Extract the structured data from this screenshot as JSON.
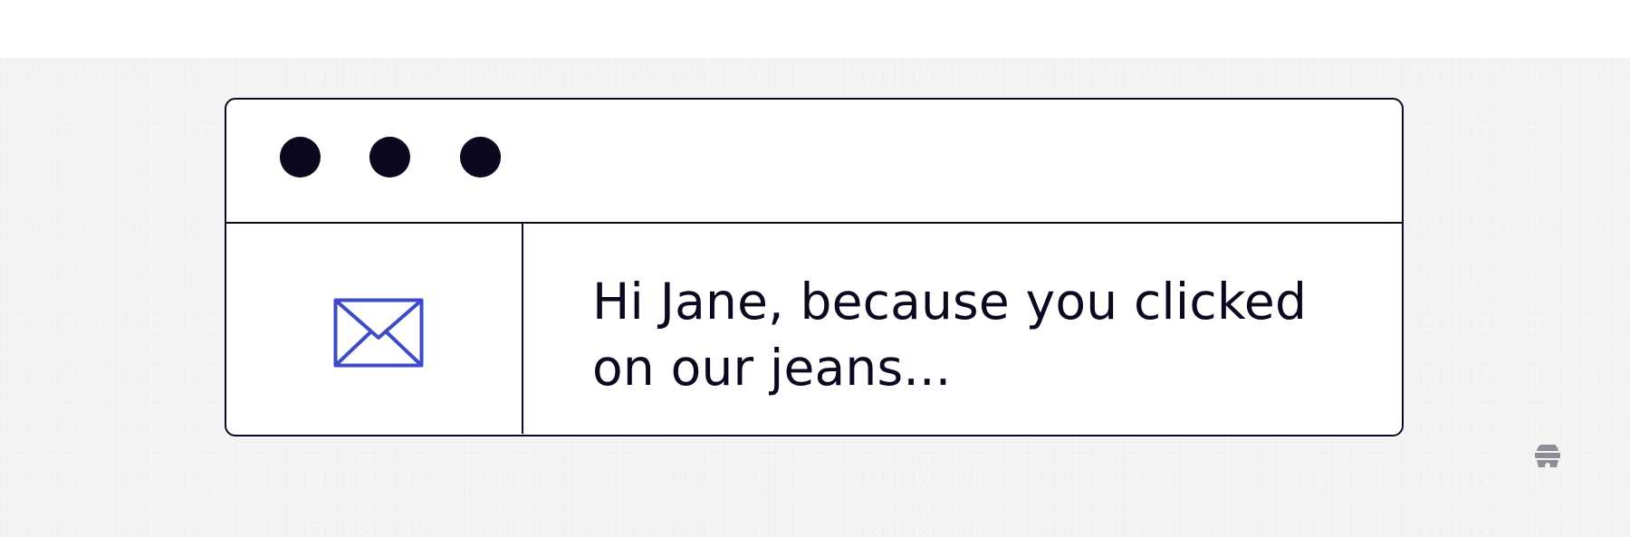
{
  "window": {
    "message": "Hi Jane, because you clicked on our jeans..."
  },
  "icons": {
    "mail": "envelope-icon",
    "brand": "beehive-icon"
  },
  "colors": {
    "outline": "#0b0820",
    "icon_accent": "#3e4bc9",
    "brand_mark": "#8d8d96",
    "backdrop": "#f4f4f4"
  }
}
